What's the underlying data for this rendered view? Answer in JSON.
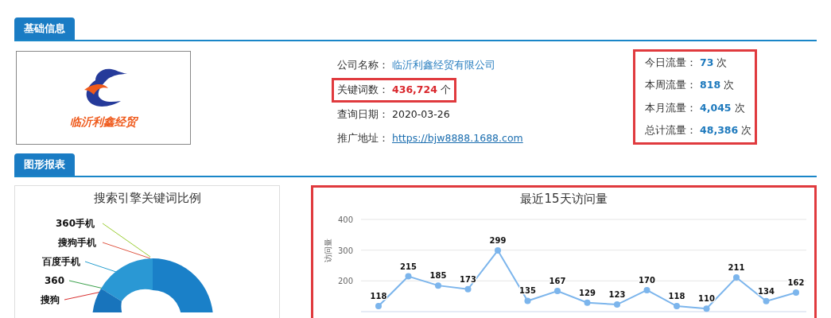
{
  "basic_info": {
    "header": "基础信息",
    "logo_text": "临沂利鑫经贸",
    "fields": [
      {
        "label": "公司名称：",
        "value": "临沂利鑫经贸有限公司",
        "kind": "company",
        "highlighted": false
      },
      {
        "label": "关键词数：",
        "value": "436,724",
        "unit": "个",
        "kind": "count",
        "highlighted": true
      },
      {
        "label": "查询日期：",
        "value": "2020-03-26",
        "kind": "plain",
        "highlighted": false
      },
      {
        "label": "推广地址：",
        "value": "https://bjw8888.1688.com",
        "kind": "url",
        "highlighted": false
      }
    ],
    "traffic_highlighted": true,
    "traffic": [
      {
        "label": "今日流量：",
        "value": "73",
        "unit": "次"
      },
      {
        "label": "本周流量：",
        "value": "818",
        "unit": "次"
      },
      {
        "label": "本月流量：",
        "value": "4,045",
        "unit": "次"
      },
      {
        "label": "总计流量：",
        "value": "48,386",
        "unit": "次"
      }
    ]
  },
  "charts": {
    "header": "图形报表",
    "donut": {
      "title": "搜索引擎关键词比例",
      "labels": [
        "360手机",
        "搜狗手机",
        "百度手机",
        "360",
        "搜狗"
      ]
    },
    "visits": {
      "highlighted": true,
      "chart_data": {
        "type": "line",
        "title": "最近15天访问量",
        "ylabel": "访问量",
        "ylim": [
          100,
          400
        ],
        "yticks": [
          200,
          300,
          400
        ],
        "data_labels": true,
        "series": [
          {
            "color": "#7cb5ec",
            "marker": "circle",
            "values": [
              118,
              215,
              185,
              173,
              299,
              135,
              167,
              129,
              123,
              170,
              118,
              110,
              211,
              134,
              162
            ]
          }
        ]
      }
    }
  }
}
